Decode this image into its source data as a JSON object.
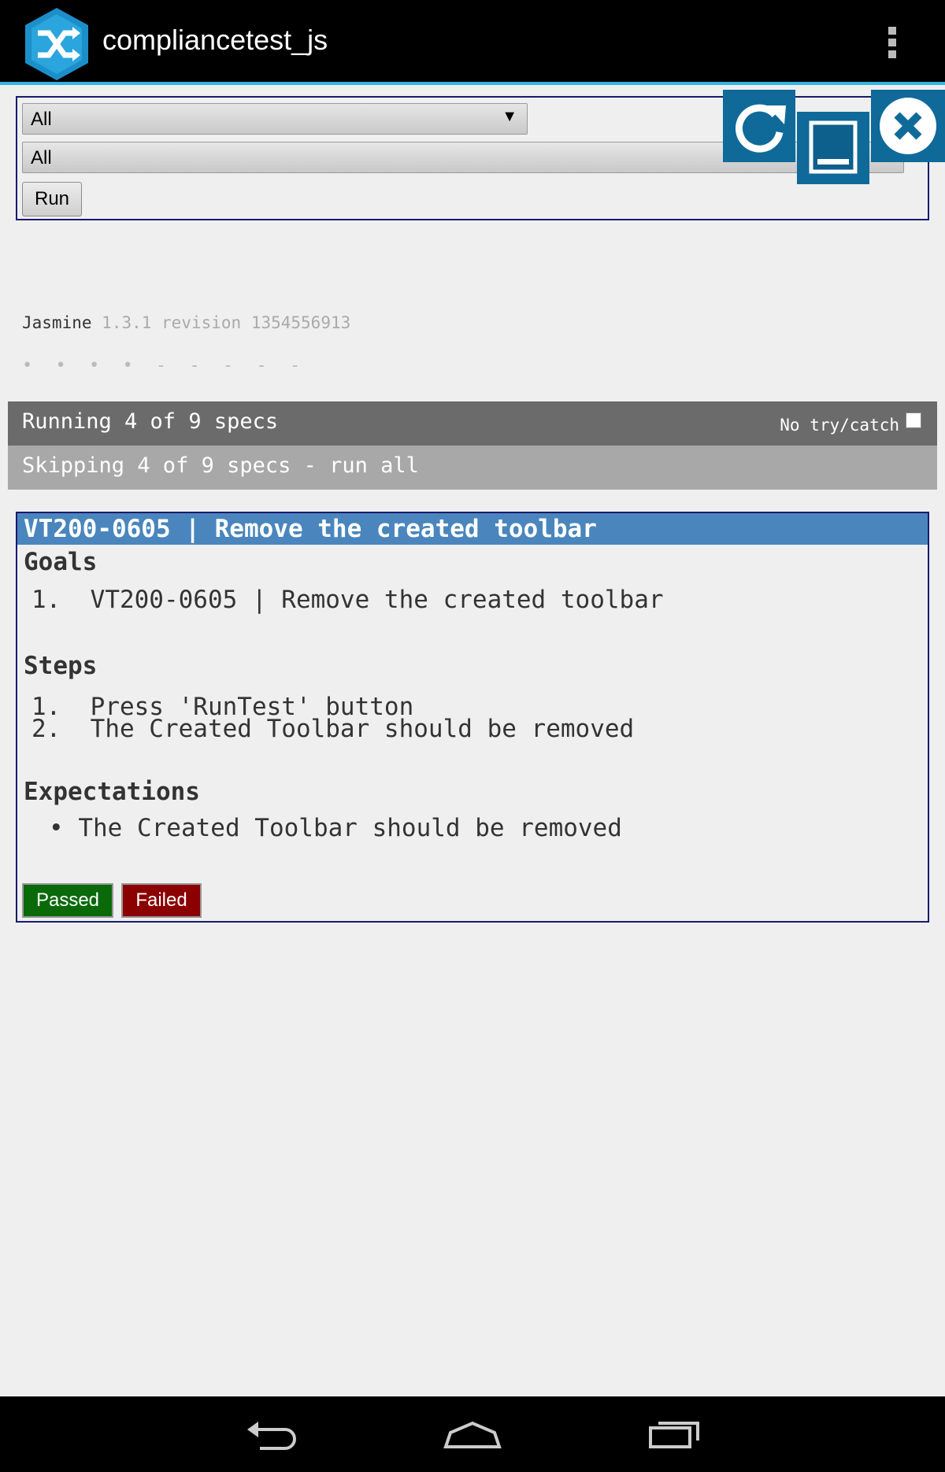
{
  "app": {
    "title": "compliancetest_js"
  },
  "controls": {
    "select1_value": "All",
    "select2_value": "All",
    "run_label": "Run"
  },
  "jasmine": {
    "name": "Jasmine",
    "version": "1.3.1 revision 1354556913",
    "symbols": "• • • • - - - - -"
  },
  "status": {
    "running": "Running 4 of 9 specs",
    "trycatch_label": "No try/catch",
    "trycatch_checked": false,
    "skipping": "Skipping 4 of 9 specs - run all"
  },
  "spec": {
    "header": "VT200-0605 | Remove the created toolbar",
    "goals_title": "Goals",
    "goals": [
      "1.  VT200-0605 | Remove the created toolbar"
    ],
    "steps_title": "Steps",
    "steps": [
      "1.  Press 'RunTest' button",
      "2.  The Created Toolbar should be removed"
    ],
    "expectations_title": "Expectations",
    "expectations": [
      "The Created Toolbar should be removed"
    ],
    "passed_label": "Passed",
    "failed_label": "Failed"
  },
  "colors": {
    "accent": "#33b5e5",
    "tile": "#0f6a9a",
    "header": "#4a86bd",
    "passed": "#0a6a0a",
    "failed": "#8b0000"
  },
  "icons": [
    "app-shuffle-icon",
    "overflow-menu-icon",
    "refresh-icon",
    "minimize-icon",
    "close-icon",
    "back-icon",
    "home-icon",
    "recents-icon"
  ]
}
